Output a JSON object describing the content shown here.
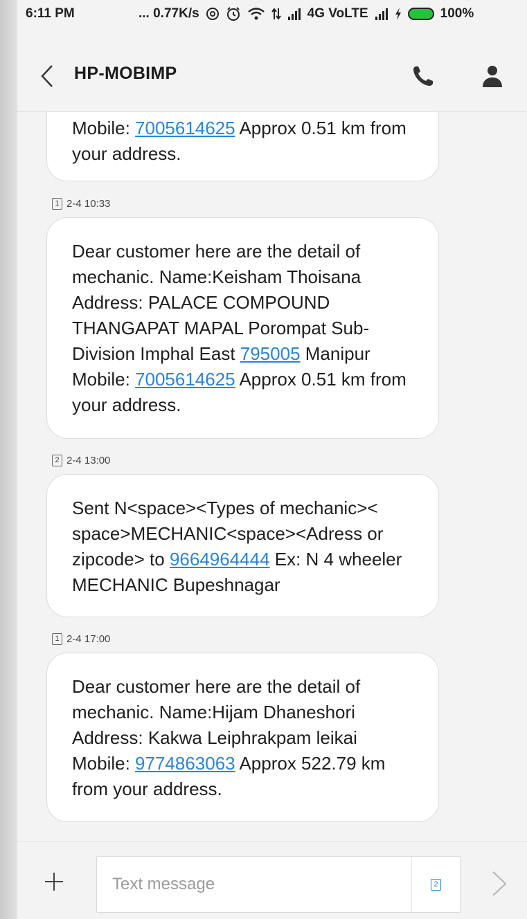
{
  "status_bar": {
    "time": "6:11 PM",
    "speed": "... 0.77K/s",
    "network": "4G VoLTE",
    "battery": "100%"
  },
  "header": {
    "title": "HP-MOBIMP"
  },
  "messages": [
    {
      "parts": [
        {
          "t": "Mobile: "
        },
        {
          "link": "7005614625"
        },
        {
          "t": " Approx 0.51 km from your address."
        }
      ]
    },
    {
      "sim": "1",
      "time": "2-4 10:33",
      "parts": [
        {
          "t": "Dear customer here are the detail of mechanic. Name:Keisham Thoisana Address: PALACE COMPOUND THANGAPAT MAPAL Porompat Sub-Division Imphal East "
        },
        {
          "link": "795005"
        },
        {
          "t": " Manipur Mobile: "
        },
        {
          "link": "7005614625"
        },
        {
          "t": " Approx 0.51 km from your address."
        }
      ]
    },
    {
      "sim": "2",
      "time": "2-4 13:00",
      "parts": [
        {
          "t": "Sent N<space><Types of mechanic>< space>MECHANIC<space><Adress or zipcode> to "
        },
        {
          "link": "9664964444"
        },
        {
          "t": " Ex: N 4 wheeler MECHANIC Bupeshnagar"
        }
      ]
    },
    {
      "sim": "1",
      "time": "2-4 17:00",
      "parts": [
        {
          "t": "Dear customer here are the detail of mechanic. Name:Hijam Dhaneshori Address: Kakwa Leiphrakpam leikai Mobile: "
        },
        {
          "link": "9774863063"
        },
        {
          "t": " Approx 522.79 km from your address."
        }
      ]
    }
  ],
  "compose": {
    "placeholder": "Text message",
    "sim": "2"
  },
  "colors": {
    "link": "#2a84d8",
    "battery": "#21c43b"
  },
  "icons": [
    "back-icon",
    "phone-icon",
    "contact-icon",
    "plus-icon",
    "send-icon",
    "sim-icon"
  ]
}
